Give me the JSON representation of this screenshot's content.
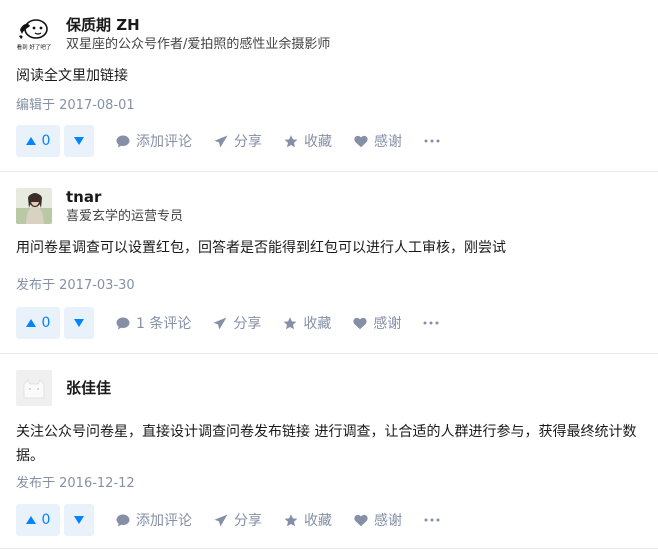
{
  "answers": [
    {
      "author_name": "保质期 ZH",
      "author_bio": "双星座的公众号作者/爱拍照的感性业余摄影师",
      "content": "阅读全文里加链接",
      "meta": "编辑于 2017-08-01",
      "votes": "0",
      "comment_label": "添加评论",
      "share_label": "分享",
      "collect_label": "收藏",
      "thanks_label": "感谢",
      "avatar_text": "看到 好了吧了"
    },
    {
      "author_name": "tnar",
      "author_bio": "喜爱玄学的运营专员",
      "content": "用问卷星调查可以设置红包，回答者是否能得到红包可以进行人工审核，刚尝试",
      "meta": "发布于 2017-03-30",
      "votes": "0",
      "comment_label": "1 条评论",
      "share_label": "分享",
      "collect_label": "收藏",
      "thanks_label": "感谢"
    },
    {
      "author_name": "张佳佳",
      "author_bio": "",
      "content": "关注公众号问卷星，直接设计调查问卷发布链接 进行调查，让合适的人群进行参与，获得最终统计数据。",
      "meta": "发布于 2016-12-12",
      "votes": "0",
      "comment_label": "添加评论",
      "share_label": "分享",
      "collect_label": "收藏",
      "thanks_label": "感谢"
    }
  ],
  "colors": {
    "accent": "#0084ff",
    "vote_bg": "#e9f2fb",
    "muted": "#8590a6"
  },
  "icons": [
    "triangle-up-icon",
    "triangle-down-icon",
    "comment-icon",
    "paper-plane-icon",
    "star-icon",
    "heart-icon",
    "ellipsis-icon"
  ]
}
